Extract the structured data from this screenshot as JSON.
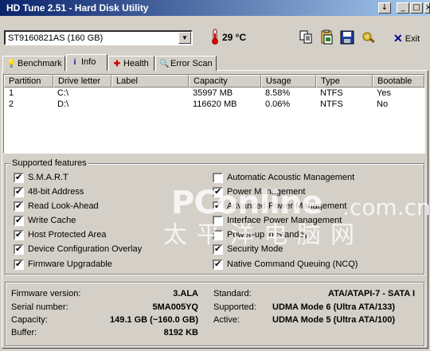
{
  "window": {
    "title": "HD Tune 2.51 - Hard Disk Utility",
    "buttons": [
      "↓",
      "_",
      "□",
      "×"
    ]
  },
  "toolbar": {
    "drive": "ST9160821AS (160 GB)",
    "temperature": "29 °C",
    "exit_label": "Exit",
    "icons": [
      "copy-text-icon",
      "copy-screenshot-icon",
      "save-icon",
      "options-icon"
    ]
  },
  "tabs": [
    {
      "label": "Benchmark",
      "icon": "benchmark-icon"
    },
    {
      "label": "Info",
      "icon": "info-icon"
    },
    {
      "label": "Health",
      "icon": "health-icon"
    },
    {
      "label": "Error Scan",
      "icon": "error-scan-icon"
    }
  ],
  "partitions": {
    "columns": [
      "Partition",
      "Drive letter",
      "Label",
      "Capacity",
      "Usage",
      "Type",
      "Bootable"
    ],
    "rows": [
      [
        "1",
        "C:\\",
        "",
        "35997 MB",
        "8.58%",
        "NTFS",
        "Yes"
      ],
      [
        "2",
        "D:\\",
        "",
        "116620 MB",
        "0.06%",
        "NTFS",
        "No"
      ]
    ]
  },
  "features": {
    "title": "Supported features",
    "left": [
      {
        "label": "S.M.A.R.T",
        "checked": true
      },
      {
        "label": "48-bit Address",
        "checked": true
      },
      {
        "label": "Read Look-Ahead",
        "checked": true
      },
      {
        "label": "Write Cache",
        "checked": true
      },
      {
        "label": "Host Protected Area",
        "checked": true
      },
      {
        "label": "Device Configuration Overlay",
        "checked": true
      },
      {
        "label": "Firmware Upgradable",
        "checked": true
      }
    ],
    "right": [
      {
        "label": "Automatic Acoustic Management",
        "checked": false
      },
      {
        "label": "Power Management",
        "checked": true
      },
      {
        "label": "Advanced Power Management",
        "checked": true
      },
      {
        "label": "Interface Power Management",
        "checked": false
      },
      {
        "label": "Power-up in Standby",
        "checked": false
      },
      {
        "label": "Security Mode",
        "checked": true
      },
      {
        "label": "Native Command Queuing (NCQ)",
        "checked": true
      }
    ]
  },
  "info": {
    "firmware_label": "Firmware version:",
    "firmware": "3.ALA",
    "serial_label": "Serial number:",
    "serial": "5MA005YQ",
    "capacity_label": "Capacity:",
    "capacity": "149.1 GB (~160.0 GB)",
    "buffer_label": "Buffer:",
    "buffer": "8192 KB",
    "standard_label": "Standard:",
    "standard": "ATA/ATAPI-7 - SATA I",
    "supported_label": "Supported:",
    "supported": "UDMA Mode 6 (Ultra ATA/133)",
    "active_label": "Active:",
    "active": "UDMA Mode 5 (Ultra ATA/100)"
  },
  "watermark": {
    "logo": "PConline",
    "domain": ".com.cn",
    "chinese": "太平洋电脑网"
  }
}
